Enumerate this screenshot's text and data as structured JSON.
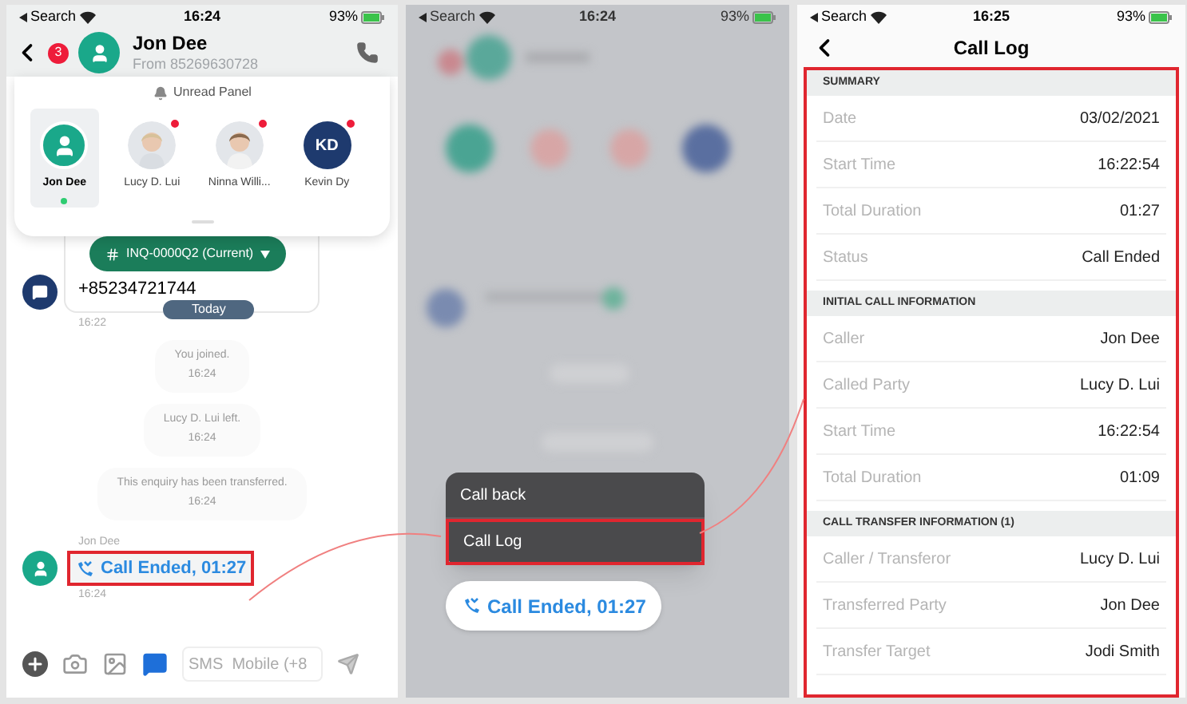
{
  "chat_screen": {
    "status_bar": {
      "carrier": "Search",
      "time": "16:24",
      "battery": "93%"
    },
    "header": {
      "unread_count": "3",
      "name": "Jon Dee",
      "subtitle": "From 85269630728"
    },
    "unread_panel": {
      "title": "Unread Panel",
      "contacts": [
        {
          "name": "Jon Dee",
          "kind": "default",
          "selected": true,
          "unread": false,
          "online": true
        },
        {
          "name": "Lucy D. Lui",
          "selected": false,
          "unread": true,
          "online": false
        },
        {
          "name": "Ninna Willi...",
          "selected": false,
          "unread": true,
          "online": false
        },
        {
          "name": "Kevin Dy",
          "kind": "initials",
          "initials": "KD",
          "selected": false,
          "unread": true,
          "online": false
        }
      ]
    },
    "enquiry_pill": "INQ-0000Q2 (Current)",
    "incoming": {
      "text": "+85234721744",
      "time": "16:22"
    },
    "date_chip": "Today",
    "system_messages": [
      {
        "text": "You joined.",
        "time": "16:24"
      },
      {
        "text": "Lucy D. Lui left.",
        "time": "16:24"
      },
      {
        "text": "This enquiry has been transferred.",
        "time": "16:24"
      }
    ],
    "call_message": {
      "sender": "Jon Dee",
      "text": "Call Ended, 01:27",
      "time": "16:24",
      "highlighted": true
    },
    "composer": {
      "placeholder": "SMS  Mobile (+8"
    }
  },
  "action_screen": {
    "status_bar": {
      "carrier": "Search",
      "time": "16:24",
      "battery": "93%"
    },
    "menu": [
      {
        "label": "Call back",
        "highlighted": false
      },
      {
        "label": "Call Log",
        "highlighted": true
      }
    ],
    "call_bubble": "Call Ended, 01:27"
  },
  "call_log_screen": {
    "status_bar": {
      "carrier": "Search",
      "time": "16:25",
      "battery": "93%"
    },
    "title": "Call Log",
    "highlighted": true,
    "sections": [
      {
        "title": "SUMMARY",
        "rows": [
          {
            "label": "Date",
            "value": "03/02/2021"
          },
          {
            "label": "Start Time",
            "value": "16:22:54"
          },
          {
            "label": "Total Duration",
            "value": "01:27"
          },
          {
            "label": "Status",
            "value": "Call Ended"
          }
        ]
      },
      {
        "title": "INITIAL CALL INFORMATION",
        "rows": [
          {
            "label": "Caller",
            "value": "Jon Dee"
          },
          {
            "label": "Called Party",
            "value": "Lucy D. Lui"
          },
          {
            "label": "Start Time",
            "value": "16:22:54"
          },
          {
            "label": "Total Duration",
            "value": "01:09"
          }
        ]
      },
      {
        "title": "CALL TRANSFER INFORMATION (1)",
        "rows": [
          {
            "label": "Caller / Transferor",
            "value": "Lucy D. Lui"
          },
          {
            "label": "Transferred Party",
            "value": "Jon Dee"
          },
          {
            "label": "Transfer Target",
            "value": "Jodi Smith"
          }
        ]
      }
    ]
  }
}
